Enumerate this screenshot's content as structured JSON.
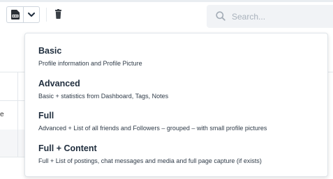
{
  "toolbar": {
    "pdf_icon": "pdf-file-icon",
    "caret_icon": "chevron-down-icon",
    "trash_icon": "trash-icon"
  },
  "search": {
    "placeholder": "Search...",
    "icon": "search-icon"
  },
  "background": {
    "row_glyph": "e"
  },
  "export_menu": {
    "items": [
      {
        "title": "Basic",
        "description": "Profile information and Profile Picture"
      },
      {
        "title": "Advanced",
        "description": "Basic + statistics from Dashboard, Tags, Notes"
      },
      {
        "title": "Full",
        "description": "Advanced + List of all friends and Followers – grouped – with small profile pictures"
      },
      {
        "title": "Full + Content",
        "description": "Full + List of postings, chat messages and media and full page capture (if exists)"
      }
    ]
  },
  "colors": {
    "text": "#1f2d3d",
    "border": "#dfe4e9",
    "search_bg": "#f1f3f6"
  }
}
